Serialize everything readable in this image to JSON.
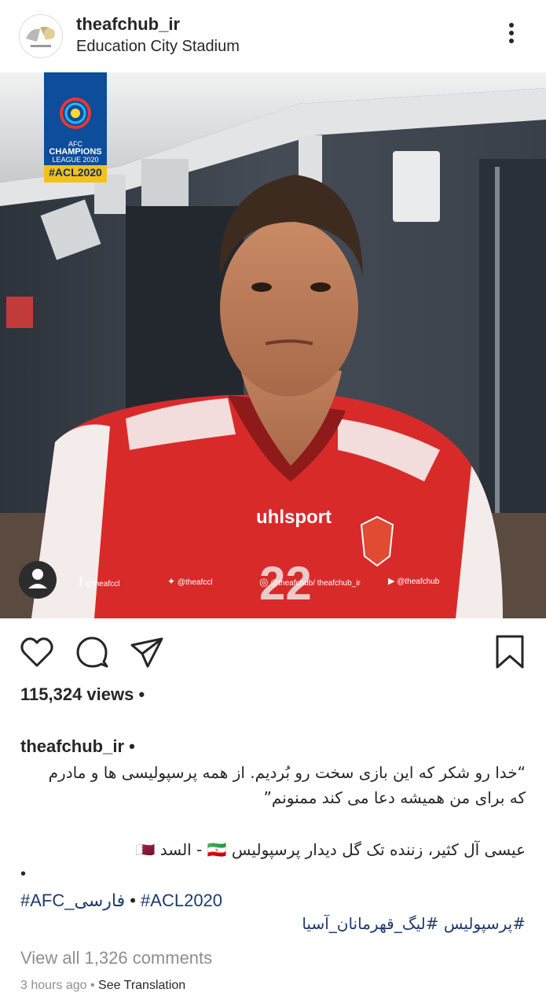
{
  "post": {
    "username": "theafchub_ir",
    "location": "Education City Stadium"
  },
  "media": {
    "badge_line1": "AFC",
    "badge_line2": "CHAMPIONS",
    "badge_line3": "LEAGUE 2020",
    "badge_hashtag": "#ACL2020",
    "jersey_brand": "uhlsport",
    "jersey_number": "22",
    "socials": [
      {
        "icon": "facebook-icon",
        "handle": "@theafccl"
      },
      {
        "icon": "twitter-icon",
        "handle": "@theafccl"
      },
      {
        "icon": "instagram-icon",
        "handle": "@theafchub/ theafchub_ir"
      },
      {
        "icon": "youtube-icon",
        "handle": "@theafchub"
      }
    ]
  },
  "stats": {
    "views": "115,324 views •"
  },
  "caption": {
    "username": "theafchub_ir •",
    "line1": "“خدا رو شکر که این بازی سخت رو بُردیم. از همه پرسپولیسی ها و مادرم",
    "line2": "که برای من همیشه دعا می کند ممنونم”",
    "line3": "عیسی آل کثیر، زننده تک گل دیدار پرسپولیس 🇮🇷 - السد 🇶🇦",
    "dot": "•",
    "tag1": "#AFC_فارسی",
    "sep": " • ",
    "tag2": "#ACL2020",
    "tags2": "#پرسپولیس #لیگ_قهرمانان_آسیا"
  },
  "footer": {
    "comments": "View all 1,326 comments",
    "time": "3 hours ago",
    "sep": " • ",
    "see_translation": "See Translation"
  },
  "colors": {
    "text": "#262626",
    "muted": "#8e8e8e",
    "hashtag": "#1e3a6b",
    "jersey_red": "#d92a2a",
    "badge_blue": "#0d4d9a",
    "badge_gold": "#f2c21b"
  }
}
